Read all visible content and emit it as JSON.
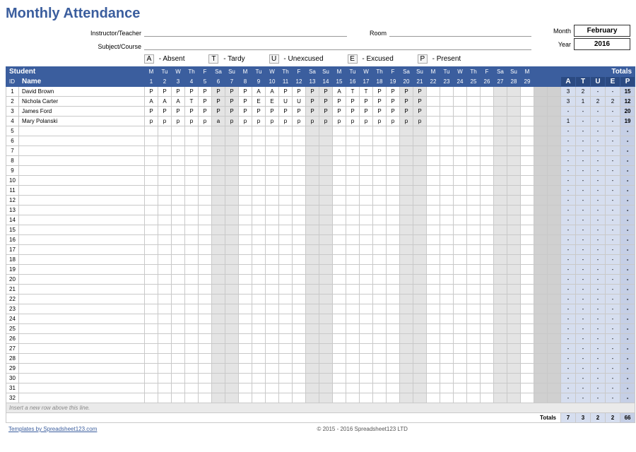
{
  "title": "Monthly Attendance",
  "labels": {
    "instructor": "Instructor/Teacher",
    "subject": "Subject/Course",
    "room": "Room",
    "month": "Month",
    "year": "Year",
    "student": "Student",
    "id": "ID",
    "name": "Name",
    "totals": "Totals",
    "insert_hint": "Insert a new row above this line.",
    "templates_by": "Templates by Spreadsheet123.com",
    "copyright": "© 2015 - 2016 Spreadsheet123 LTD",
    "footer_totals": "Totals"
  },
  "month": "February",
  "year": "2016",
  "legend": [
    {
      "code": "A",
      "desc": "- Absent"
    },
    {
      "code": "T",
      "desc": "- Tardy"
    },
    {
      "code": "U",
      "desc": "- Unexcused"
    },
    {
      "code": "E",
      "desc": "- Excused"
    },
    {
      "code": "P",
      "desc": "- Present"
    }
  ],
  "days": [
    {
      "n": 1,
      "dow": "M",
      "we": false
    },
    {
      "n": 2,
      "dow": "Tu",
      "we": false
    },
    {
      "n": 3,
      "dow": "W",
      "we": false
    },
    {
      "n": 4,
      "dow": "Th",
      "we": false
    },
    {
      "n": 5,
      "dow": "F",
      "we": false
    },
    {
      "n": 6,
      "dow": "Sa",
      "we": true
    },
    {
      "n": 7,
      "dow": "Su",
      "we": true
    },
    {
      "n": 8,
      "dow": "M",
      "we": false
    },
    {
      "n": 9,
      "dow": "Tu",
      "we": false
    },
    {
      "n": 10,
      "dow": "W",
      "we": false
    },
    {
      "n": 11,
      "dow": "Th",
      "we": false
    },
    {
      "n": 12,
      "dow": "F",
      "we": false
    },
    {
      "n": 13,
      "dow": "Sa",
      "we": true
    },
    {
      "n": 14,
      "dow": "Su",
      "we": true
    },
    {
      "n": 15,
      "dow": "M",
      "we": false
    },
    {
      "n": 16,
      "dow": "Tu",
      "we": false
    },
    {
      "n": 17,
      "dow": "W",
      "we": false
    },
    {
      "n": 18,
      "dow": "Th",
      "we": false
    },
    {
      "n": 19,
      "dow": "F",
      "we": false
    },
    {
      "n": 20,
      "dow": "Sa",
      "we": true
    },
    {
      "n": 21,
      "dow": "Su",
      "we": true
    },
    {
      "n": 22,
      "dow": "M",
      "we": false
    },
    {
      "n": 23,
      "dow": "Tu",
      "we": false
    },
    {
      "n": 24,
      "dow": "W",
      "we": false
    },
    {
      "n": 25,
      "dow": "Th",
      "we": false
    },
    {
      "n": 26,
      "dow": "F",
      "we": false
    },
    {
      "n": 27,
      "dow": "Sa",
      "we": true
    },
    {
      "n": 28,
      "dow": "Su",
      "we": true
    },
    {
      "n": 29,
      "dow": "M",
      "we": false
    }
  ],
  "extra_days": 2,
  "tot_headers": [
    "A",
    "T",
    "U",
    "E",
    "P"
  ],
  "students": [
    {
      "id": 1,
      "name": "David Brown",
      "marks": [
        "P",
        "P",
        "P",
        "P",
        "P",
        "P",
        "P",
        "P",
        "A",
        "A",
        "P",
        "P",
        "P",
        "P",
        "A",
        "T",
        "T",
        "P",
        "P",
        "P",
        "P"
      ],
      "totals": {
        "A": "3",
        "T": "2",
        "U": "-",
        "E": "-",
        "P": "15"
      }
    },
    {
      "id": 2,
      "name": "Nichola Carter",
      "marks": [
        "A",
        "A",
        "A",
        "T",
        "P",
        "P",
        "P",
        "P",
        "E",
        "E",
        "U",
        "U",
        "P",
        "P",
        "P",
        "P",
        "P",
        "P",
        "P",
        "P",
        "P"
      ],
      "totals": {
        "A": "3",
        "T": "1",
        "U": "2",
        "E": "2",
        "P": "12"
      }
    },
    {
      "id": 3,
      "name": "James Ford",
      "marks": [
        "P",
        "P",
        "P",
        "P",
        "P",
        "P",
        "P",
        "P",
        "P",
        "P",
        "P",
        "P",
        "P",
        "P",
        "P",
        "P",
        "P",
        "P",
        "P",
        "P",
        "P"
      ],
      "totals": {
        "A": "-",
        "T": "-",
        "U": "-",
        "E": "-",
        "P": "20"
      }
    },
    {
      "id": 4,
      "name": "Mary Polanski",
      "marks": [
        "p",
        "p",
        "p",
        "p",
        "p",
        "a",
        "p",
        "p",
        "p",
        "p",
        "p",
        "p",
        "p",
        "p",
        "p",
        "p",
        "p",
        "p",
        "p",
        "p",
        "p"
      ],
      "totals": {
        "A": "1",
        "T": "-",
        "U": "-",
        "E": "-",
        "P": "19"
      }
    }
  ],
  "empty_rows": [
    5,
    6,
    7,
    8,
    9,
    10,
    11,
    12,
    13,
    14,
    15,
    16,
    17,
    18,
    19,
    20,
    21,
    22,
    23,
    24,
    25,
    26,
    27,
    28,
    29,
    30,
    31,
    32
  ],
  "grand_totals": {
    "A": "7",
    "T": "3",
    "U": "2",
    "E": "2",
    "P": "66"
  }
}
